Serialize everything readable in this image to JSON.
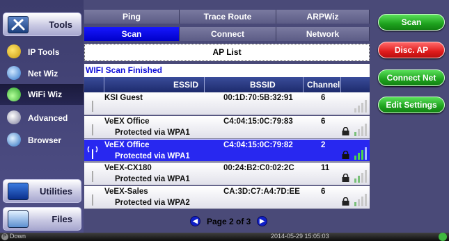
{
  "sidebar": {
    "tools_label": "Tools",
    "items": [
      {
        "label": "IP Tools"
      },
      {
        "label": "Net Wiz"
      },
      {
        "label": "WiFi Wiz"
      },
      {
        "label": "Advanced"
      },
      {
        "label": "Browser"
      }
    ],
    "utilities_label": "Utilities",
    "files_label": "Files"
  },
  "tabs": {
    "row1": [
      "Ping",
      "Trace Route",
      "ARPWiz"
    ],
    "row2": [
      "Scan",
      "Connect",
      "Network"
    ],
    "active": "Scan"
  },
  "main": {
    "title": "AP List",
    "status": "WIFI Scan Finished",
    "columns": [
      "ESSID",
      "BSSID",
      "Channel"
    ],
    "rows": [
      {
        "essid": "KSI Guest",
        "security": "",
        "bssid": "00:1D:70:5B:32:91",
        "channel": "6",
        "locked": false,
        "selected": false
      },
      {
        "essid": "VeEX Office",
        "security": "Protected via WPA1",
        "bssid": "C4:04:15:0C:79:83",
        "channel": "6",
        "locked": true,
        "selected": false
      },
      {
        "essid": "VeEX Office",
        "security": "Protected via WPA1",
        "bssid": "C4:04:15:0C:79:82",
        "channel": "2",
        "locked": true,
        "selected": true
      },
      {
        "essid": "VeEX-CX180",
        "security": "Protected via WPA1",
        "bssid": "00:24:B2:C0:02:2C",
        "channel": "11",
        "locked": true,
        "selected": false
      },
      {
        "essid": "VeEX-Sales",
        "security": "Protected via WPA2",
        "bssid": "CA:3D:C7:A4:7D:EE",
        "channel": "6",
        "locked": true,
        "selected": false
      }
    ],
    "pager": "Page 2 of 3"
  },
  "actions": {
    "scan": "Scan",
    "disc_ap": "Disc. AP",
    "connect_net": "Connect Net",
    "edit_settings": "Edit Settings"
  },
  "statusbar": {
    "link": "Down",
    "datetime": "2014-05-29  15:05:03"
  },
  "colors": {
    "active_tab": "#0000e6",
    "selected_row": "#2828f0",
    "status_text": "#1010d8",
    "green_button": "#1ea21e",
    "red_button": "#e01c1c"
  }
}
